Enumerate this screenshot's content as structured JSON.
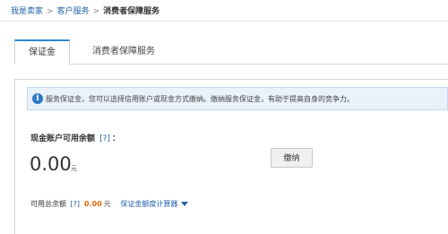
{
  "breadcrumb": {
    "items": [
      "我是卖家",
      "客户服务",
      "消费者保障服务"
    ],
    "separator": ">"
  },
  "tabs": [
    {
      "label": "保证金",
      "active": true
    },
    {
      "label": "消费者保障服务",
      "active": false
    }
  ],
  "notice": {
    "icon": "info-icon",
    "icon_glyph": "i",
    "text": "服务保证金，您可以选择信用账户或现金方式缴纳。缴纳服务保证金，有助于提高自身的竞争力。"
  },
  "cash_account": {
    "label": "现金账户可用余额",
    "help": "[?]",
    "colon": "：",
    "amount": "0.00",
    "unit": "元",
    "pay_button": "缴纳"
  },
  "total": {
    "label": "可用总余额",
    "help": "[?]",
    "amount": "0.00",
    "unit": "元",
    "calculator_link": "保证金额度计算器",
    "calculator_icon": "caret-down-icon"
  },
  "colors": {
    "link": "#1f5fa8",
    "accent_tab": "#2f8ad3",
    "notice_bg": "#e9f1fa",
    "amount_highlight": "#e46a0c"
  }
}
